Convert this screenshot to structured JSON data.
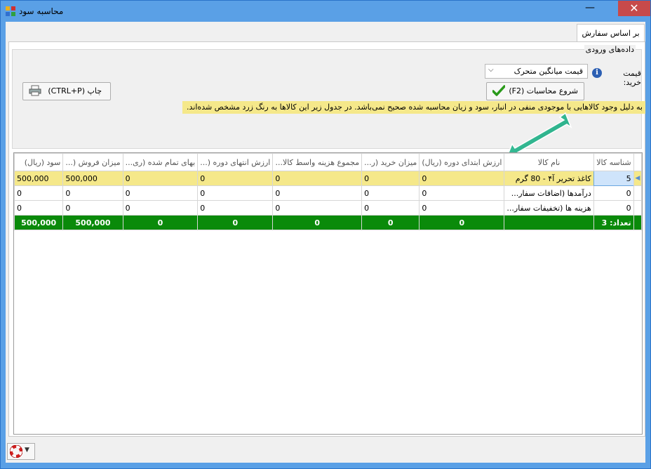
{
  "window": {
    "title": "محاسبه سود",
    "close_glyph": "✕",
    "min_glyph": "—"
  },
  "tabs": [
    {
      "label": "بر اساس سفارش"
    }
  ],
  "inputs": {
    "group_label": "داده‌های ورودی",
    "purchase_price_label": "قیمت خرید:",
    "purchase_price_value": "قیمت میانگین متحرک",
    "start_button_label": "شروع محاسبات (F2)",
    "print_button_label": "چاپ (CTRL+P)"
  },
  "warning_text": "به دلیل وجود کالاهایی با موجودی منفی در انبار، سود و زیان محاسبه شده صحیح نمی‌باشد. در جدول زیر این کالاها به رنگ زرد مشخص شده‌اند.",
  "grid": {
    "columns": [
      "شناسه کالا",
      "نام کالا",
      "ارزش ابتدای دوره (ریال)",
      "میزان خرید (ر...",
      "مجموع هزینه واسط کالا...",
      "ارزش انتهای دوره (...",
      "بهای تمام شده (ری...",
      "میزان فروش (...",
      "سود (ریال)"
    ],
    "rows": [
      [
        "5",
        "کاغذ تحریر آ۴ - 80 گرم",
        "0",
        "0",
        "0",
        "0",
        "0",
        "500,000",
        "500,000"
      ],
      [
        "0",
        "درآمدها (اضافات سفار...",
        "0",
        "0",
        "0",
        "0",
        "0",
        "0",
        "0"
      ],
      [
        "0",
        "هزینه ها (تخفیفات سفار...",
        "0",
        "0",
        "0",
        "0",
        "0",
        "0",
        "0"
      ]
    ],
    "total": [
      "تعداد: 3",
      "",
      "0",
      "0",
      "0",
      "0",
      "0",
      "500,000",
      "500,000"
    ],
    "selected_row": 0
  },
  "colors": {
    "highlight": "#f5e88a",
    "total_row": "#0a8a0a",
    "titlebar": "#5aa0e6",
    "close": "#c74a4a"
  },
  "icons": [
    "app-icon",
    "info-icon",
    "checkmark-icon",
    "printer-icon",
    "lifebuoy-icon",
    "chevron-down-icon"
  ]
}
